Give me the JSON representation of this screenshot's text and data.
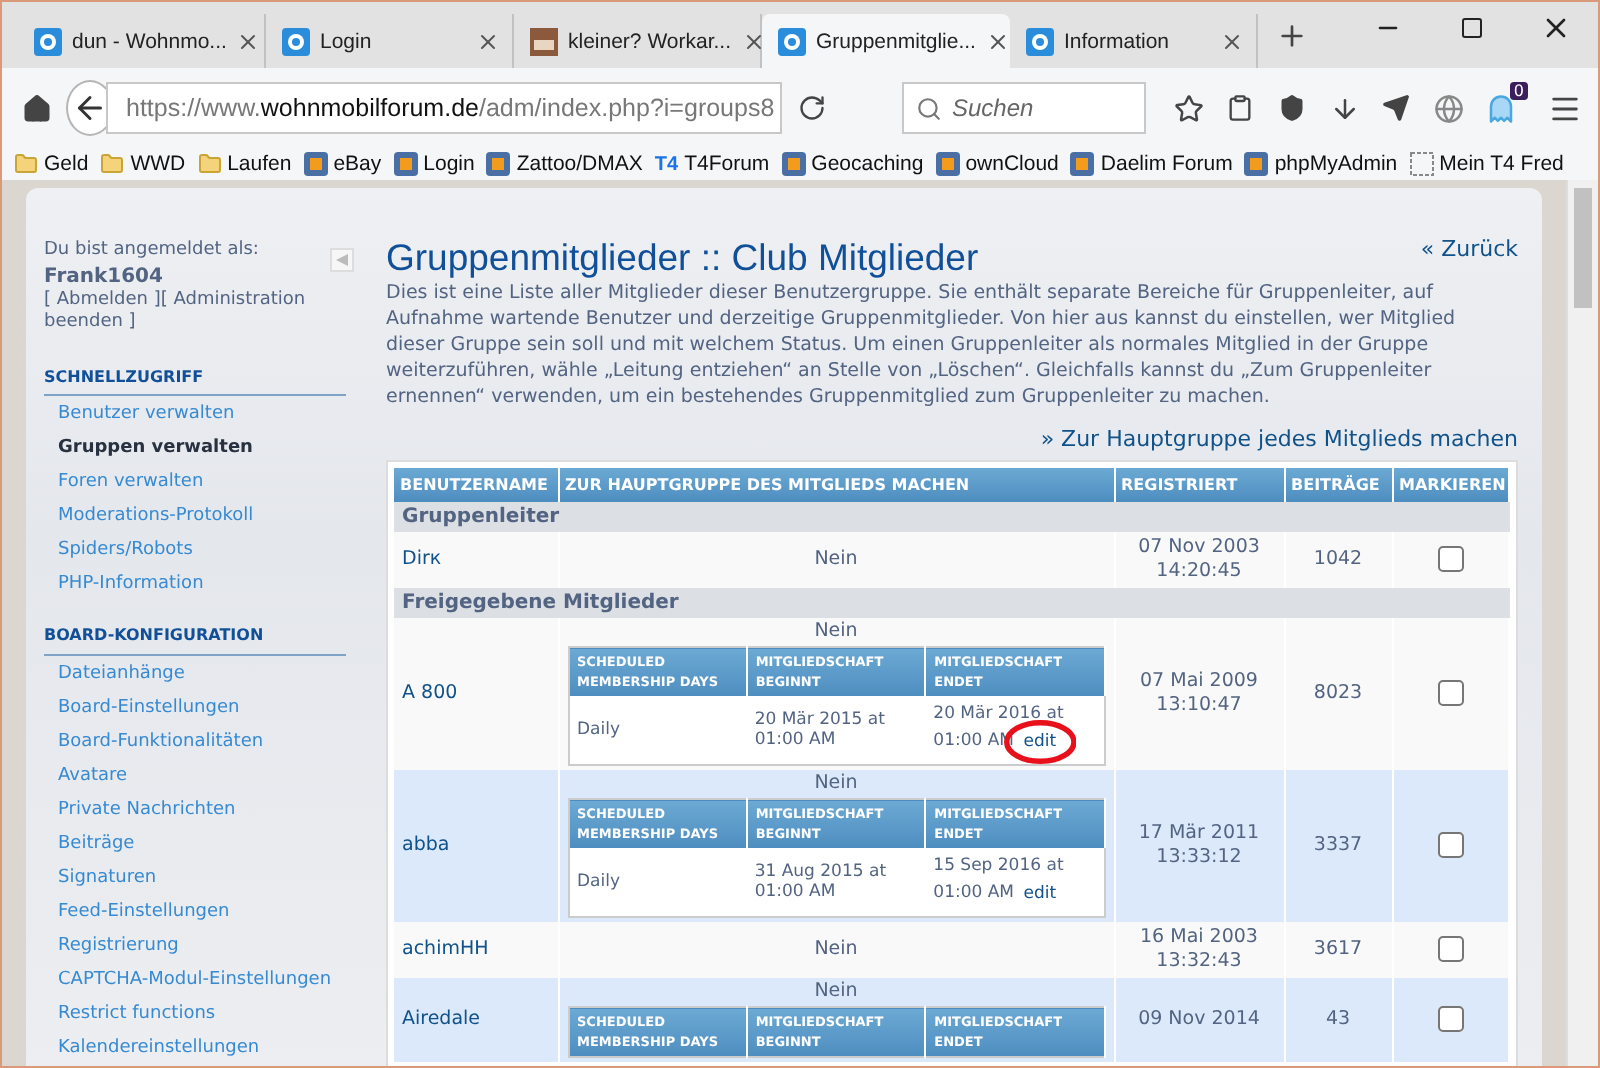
{
  "browser": {
    "tabs": [
      {
        "title": "dun - Wohnmo...",
        "kind": "site",
        "selected": false
      },
      {
        "title": "Login",
        "kind": "site",
        "selected": false
      },
      {
        "title": "kleiner? Workar...",
        "kind": "image",
        "selected": false
      },
      {
        "title": "Gruppenmitglie...",
        "kind": "site",
        "selected": true
      },
      {
        "title": "Information",
        "kind": "site",
        "selected": false
      }
    ],
    "url": {
      "host_prefix": "https://www.",
      "domain": "wohnmobilforum.de",
      "path": "/adm/index.php?i=groups8"
    },
    "search": {
      "placeholder": "Suchen"
    },
    "extension_badge": "0",
    "bookmarks": [
      {
        "label": "Geld",
        "kind": "folder"
      },
      {
        "label": "WWD",
        "kind": "folder"
      },
      {
        "label": "Laufen",
        "kind": "folder"
      },
      {
        "label": "eBay",
        "kind": "site"
      },
      {
        "label": "Login",
        "kind": "site"
      },
      {
        "label": "Zattoo/DMAX",
        "kind": "site"
      },
      {
        "label": "T4Forum",
        "kind": "text-logo",
        "logo": "T4"
      },
      {
        "label": "Geocaching",
        "kind": "site"
      },
      {
        "label": "ownCloud",
        "kind": "site"
      },
      {
        "label": "Daelim Forum",
        "kind": "site"
      },
      {
        "label": "phpMyAdmin",
        "kind": "site"
      },
      {
        "label": "Mein T4 Fred",
        "kind": "page"
      }
    ]
  },
  "sidebar": {
    "logged_in_label": "Du bist angemeldet als:",
    "username": "Frank1604",
    "session_links": "[ Abmelden ][ Administration beenden ]",
    "sections": [
      {
        "title": "SCHNELLZUGRIFF",
        "items": [
          {
            "label": "Benutzer verwalten",
            "selected": false
          },
          {
            "label": "Gruppen verwalten",
            "selected": true
          },
          {
            "label": "Foren verwalten",
            "selected": false
          },
          {
            "label": "Moderations-Protokoll",
            "selected": false
          },
          {
            "label": "Spiders/Robots",
            "selected": false
          },
          {
            "label": "PHP-Information",
            "selected": false
          }
        ]
      },
      {
        "title": "BOARD-KONFIGURATION",
        "items": [
          {
            "label": "Dateianhänge",
            "selected": false
          },
          {
            "label": "Board-Einstellungen",
            "selected": false
          },
          {
            "label": "Board-Funktionalitäten",
            "selected": false
          },
          {
            "label": "Avatare",
            "selected": false
          },
          {
            "label": "Private Nachrichten",
            "selected": false
          },
          {
            "label": "Beiträge",
            "selected": false
          },
          {
            "label": "Signaturen",
            "selected": false
          },
          {
            "label": "Feed-Einstellungen",
            "selected": false
          },
          {
            "label": "Registrierung",
            "selected": false
          },
          {
            "label": "CAPTCHA-Modul-Einstellungen",
            "selected": false
          },
          {
            "label": "Restrict functions",
            "selected": false
          },
          {
            "label": "Kalendereinstellungen",
            "selected": false
          }
        ]
      }
    ]
  },
  "main": {
    "title": "Gruppenmitglieder :: Club Mitglieder",
    "back_link": "« Zurück",
    "description": "Dies ist eine Liste aller Mitglieder dieser Benutzergruppe. Sie enthält separate Bereiche für Gruppenleiter, auf Aufnahme wartende Benutzer und derzeitige Gruppenmitglieder. Von hier aus kannst du einstellen, wer Mitglied dieser Gruppe sein soll und mit welchem Status. Um einen Gruppenleiter als normales Mitglied in der Gruppe weiterzuführen, wähle „Leitung entziehen“ an Stelle von „Löschen“. Gleichfalls kannst du „Zum Gruppenleiter ernennen“ verwenden, um ein bestehendes Gruppenmitglied zum Gruppenleiter zu machen.",
    "action_link": "» Zur Hauptgruppe jedes Mitglieds machen",
    "table": {
      "columns": [
        "BENUTZERNAME",
        "ZUR HAUPTGRUPPE DES MITGLIEDS MACHEN",
        "REGISTRIERT",
        "BEITRÄGE",
        "MARKIEREN"
      ],
      "rows": [
        {
          "kind": "group",
          "label": "Gruppenleiter"
        },
        {
          "kind": "member",
          "name": "Dirк",
          "default_group": "Nein",
          "registered_date": "07 Nov 2003",
          "registered_time": "14:20:45",
          "posts": "1042",
          "highlighted": false,
          "checked": false
        },
        {
          "kind": "group",
          "label": "Freigegebene Mitglieder"
        },
        {
          "kind": "member",
          "name": "A 800",
          "default_group": "Nein",
          "registered_date": "07 Mai 2009",
          "registered_time": "13:10:47",
          "posts": "8023",
          "highlighted": false,
          "checked": false,
          "schedule": {
            "columns": [
              "SCHEDULED MEMBERSHIP DAYS",
              "MITGLIEDSCHAFT BEGINNT",
              "MITGLIEDSCHAFT ENDET"
            ],
            "values": [
              "Daily",
              "20 Mär 2015 at 01:00 AM",
              "20 Mär 2016 at 01:00 AM"
            ],
            "edit": "edit",
            "circled": true
          }
        },
        {
          "kind": "member",
          "name": "abba",
          "default_group": "Nein",
          "registered_date": "17 Mär 2011",
          "registered_time": "13:33:12",
          "posts": "3337",
          "highlighted": true,
          "checked": false,
          "schedule": {
            "columns": [
              "SCHEDULED MEMBERSHIP DAYS",
              "MITGLIEDSCHAFT BEGINNT",
              "MITGLIEDSCHAFT ENDET"
            ],
            "values": [
              "Daily",
              "31 Aug 2015 at 01:00 AM",
              "15 Sep 2016 at 01:00 AM"
            ],
            "edit": "edit",
            "circled": false
          }
        },
        {
          "kind": "member",
          "name": "achimHH",
          "default_group": "Nein",
          "registered_date": "16 Mai 2003",
          "registered_time": "13:32:43",
          "posts": "3617",
          "highlighted": false,
          "checked": false
        },
        {
          "kind": "member",
          "name": "Airedale",
          "default_group": "Nein",
          "registered_date": "09 Nov 2014",
          "posts": "43",
          "highlighted": true,
          "checked": false,
          "schedule": {
            "columns": [
              "SCHEDULED MEMBERSHIP DAYS",
              "MITGLIEDSCHAFT BEGINNT",
              "MITGLIEDSCHAFT ENDET"
            ],
            "circled": false
          }
        }
      ]
    }
  }
}
